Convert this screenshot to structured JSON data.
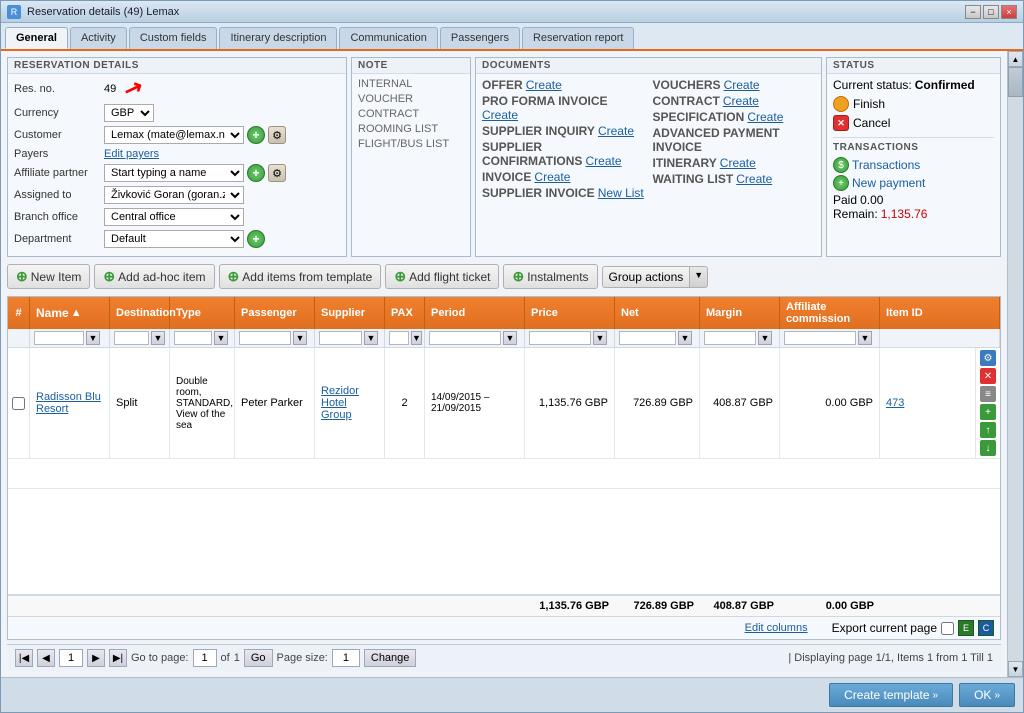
{
  "window": {
    "title": "Reservation details (49) Lemax",
    "minimize": "−",
    "maximize": "□",
    "close": "×"
  },
  "tabs": [
    {
      "label": "General",
      "active": true
    },
    {
      "label": "Activity"
    },
    {
      "label": "Custom fields"
    },
    {
      "label": "Itinerary description"
    },
    {
      "label": "Communication"
    },
    {
      "label": "Passengers"
    },
    {
      "label": "Reservation report"
    }
  ],
  "reservation_details": {
    "section_title": "RESERVATION DETAILS",
    "res_no_label": "Res. no.",
    "res_no_value": "49",
    "currency_label": "Currency",
    "currency_value": "GBP",
    "customer_label": "Customer",
    "customer_value": "Lemax (mate@lemax.net), :",
    "payers_label": "Payers",
    "payers_link": "Edit payers",
    "affiliate_label": "Affiliate partner",
    "affiliate_placeholder": "Start typing a name",
    "assigned_label": "Assigned to",
    "assigned_value": "Živković Goran (goran.zivk",
    "branch_label": "Branch office",
    "branch_value": "Central office",
    "department_label": "Department",
    "department_value": "Default"
  },
  "note": {
    "section_title": "NOTE",
    "items": [
      {
        "label": "INTERNAL"
      },
      {
        "label": "VOUCHER"
      },
      {
        "label": "CONTRACT"
      },
      {
        "label": "ROOMING LIST"
      },
      {
        "label": "FLIGHT/BUS LIST"
      }
    ]
  },
  "documents": {
    "section_title": "DOCUMENTS",
    "items": [
      {
        "name": "OFFER",
        "action": "Create"
      },
      {
        "name": "PRO FORMA INVOICE",
        "action": "Create"
      },
      {
        "name": "SUPPLIER INQUIRY",
        "action": "Create"
      },
      {
        "name": "SUPPLIER CONFIRMATIONS",
        "action": "Create"
      },
      {
        "name": "INVOICE",
        "action": "Create"
      },
      {
        "name": "SUPPLIER INVOICE",
        "action": "New List"
      },
      {
        "name": "VOUCHERS",
        "action": "Create"
      },
      {
        "name": "CONTRACT",
        "action": "Create"
      },
      {
        "name": "SPECIFICATION",
        "action": "Create"
      },
      {
        "name": "ADVANCED PAYMENT INVOICE",
        "action": ""
      },
      {
        "name": "ITINERARY",
        "action": "Create"
      },
      {
        "name": "WAITING LIST",
        "action": "Create"
      }
    ]
  },
  "status": {
    "section_title": "STATUS",
    "current_label": "Current status:",
    "current_value": "Confirmed",
    "finish_label": "Finish",
    "cancel_label": "Cancel",
    "transactions_title": "TRANSACTIONS",
    "transactions_link": "Transactions",
    "new_payment_link": "New payment",
    "paid_label": "Paid",
    "paid_value": "0.00",
    "remain_label": "Remain:",
    "remain_value": "1,135.76"
  },
  "actions": {
    "new_item": "New Item",
    "add_adhoc": "Add ad-hoc item",
    "add_template": "Add items from template",
    "add_flight": "Add flight ticket",
    "instalments": "Instalments",
    "group_actions": "Group actions"
  },
  "table": {
    "columns": [
      {
        "label": "#",
        "key": "num"
      },
      {
        "label": "Name",
        "key": "name"
      },
      {
        "label": "Destination",
        "key": "destination"
      },
      {
        "label": "Type",
        "key": "type"
      },
      {
        "label": "Passenger",
        "key": "passenger"
      },
      {
        "label": "Supplier",
        "key": "supplier"
      },
      {
        "label": "PAX",
        "key": "pax"
      },
      {
        "label": "Period",
        "key": "period"
      },
      {
        "label": "Price",
        "key": "price"
      },
      {
        "label": "Net",
        "key": "net"
      },
      {
        "label": "Margin",
        "key": "margin"
      },
      {
        "label": "Affiliate commission",
        "key": "affiliate_commission"
      },
      {
        "label": "Item ID",
        "key": "item_id"
      }
    ],
    "rows": [
      {
        "name": "Radisson Blu Resort",
        "destination": "Split",
        "type": "Double room, STANDARD, View of the sea",
        "passenger": "Peter Parker",
        "supplier": "Rezidor Hotel Group",
        "pax": "2",
        "period": "14/09/2015 – 21/09/2015",
        "price": "1,135.76 GBP",
        "net": "726.89 GBP",
        "margin": "408.87 GBP",
        "affiliate_commission": "0.00 GBP",
        "item_id": "473"
      }
    ],
    "totals": {
      "price": "1,135.76 GBP",
      "net": "726.89 GBP",
      "margin": "408.87 GBP",
      "affiliate_commission": "0.00 GBP"
    },
    "edit_columns": "Edit columns",
    "export_label": "Export current page"
  },
  "pagination": {
    "go_to_page_label": "Go to page:",
    "current_page": "1",
    "of_label": "of",
    "total_pages": "1",
    "go_button": "Go",
    "page_size_label": "Page size:",
    "page_size": "1",
    "change_button": "Change",
    "display_info": "| Displaying page 1/1, Items 1 from 1 Till 1"
  },
  "bottom": {
    "create_template": "Create template",
    "ok": "OK"
  }
}
